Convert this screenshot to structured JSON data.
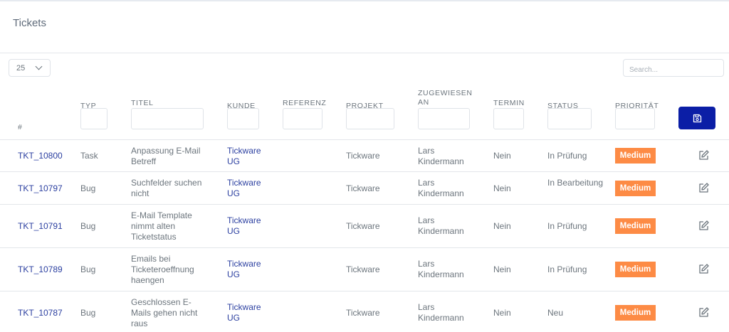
{
  "page": {
    "title": "Tickets"
  },
  "toolbar": {
    "page_size": "25",
    "search_placeholder": "Search..."
  },
  "table": {
    "columns": {
      "number": "#",
      "type": "TYP",
      "title": "TITEL",
      "customer": "KUNDE",
      "reference": "REFERENZ",
      "project": "PROJEKT",
      "assigned": "ZUGEWIESEN AN",
      "appointment": "TERMIN",
      "status": "STATUS",
      "priority": "PRIORITÄT"
    },
    "rows": [
      {
        "id": "TKT_10800",
        "type": "Task",
        "title": "Anpassung E-Mail Betreff",
        "customer": "Tickware UG",
        "reference": "",
        "project": "Tickware",
        "assigned": "Lars Kindermann",
        "appointment": "Nein",
        "status": "In Prüfung",
        "priority": "Medium"
      },
      {
        "id": "TKT_10797",
        "type": "Bug",
        "title": "Suchfelder suchen nicht",
        "customer": "Tickware UG",
        "reference": "",
        "project": "Tickware",
        "assigned": "Lars Kindermann",
        "appointment": "Nein",
        "status": "In Bearbeitung",
        "priority": "Medium"
      },
      {
        "id": "TKT_10791",
        "type": "Bug",
        "title": "E-Mail Template nimmt alten Ticketstatus",
        "customer": "Tickware UG",
        "reference": "",
        "project": "Tickware",
        "assigned": "Lars Kindermann",
        "appointment": "Nein",
        "status": "In Prüfung",
        "priority": "Medium"
      },
      {
        "id": "TKT_10789",
        "type": "Bug",
        "title": "Emails bei Ticketeroeffnung haengen",
        "customer": "Tickware UG",
        "reference": "",
        "project": "Tickware",
        "assigned": "Lars Kindermann",
        "appointment": "Nein",
        "status": "In Prüfung",
        "priority": "Medium"
      },
      {
        "id": "TKT_10787",
        "type": "Bug",
        "title": "Geschlossen E-Mails gehen nicht raus",
        "customer": "Tickware UG",
        "reference": "",
        "project": "Tickware",
        "assigned": "Lars Kindermann",
        "appointment": "Nein",
        "status": "Neu",
        "priority": "Medium"
      }
    ]
  },
  "colors": {
    "accent": "#0b1ea6",
    "link": "#2b3fa0",
    "priority_medium": "#fd8b45"
  },
  "icons": {
    "save": "save-icon",
    "edit": "edit-icon",
    "dropdown": "chevron-down-icon"
  }
}
